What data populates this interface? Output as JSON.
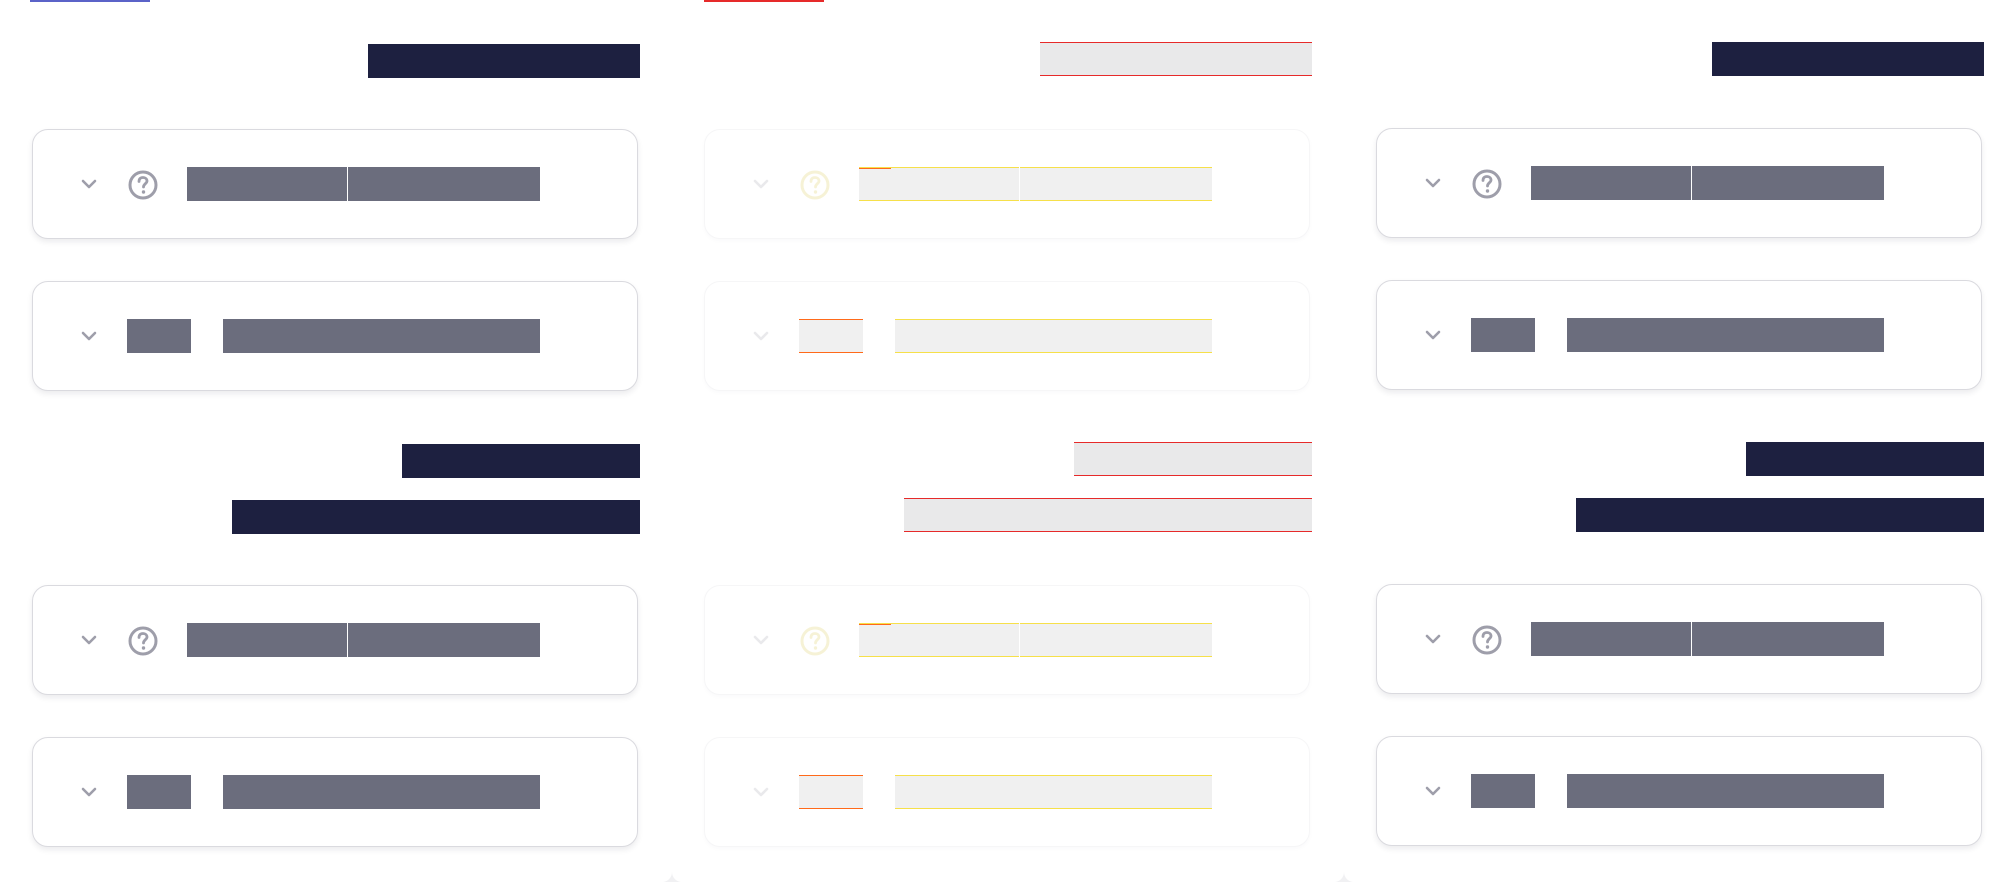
{
  "panels": [
    {
      "headings": [
        "",
        "",
        ""
      ],
      "cards": [
        {
          "icon": "help-circle-icon",
          "value_a": "",
          "value_b": ""
        },
        {
          "code": "",
          "value_a": "",
          "value_b": ""
        },
        {
          "icon": "help-circle-icon",
          "value_a": "",
          "value_b": ""
        },
        {
          "code": "",
          "value_a": "",
          "value_b": ""
        }
      ]
    },
    {
      "headings": [
        "",
        "",
        ""
      ],
      "cards": [
        {
          "icon": "help-circle-icon",
          "value_a": "",
          "value_b": ""
        },
        {
          "code": "",
          "value_a": "",
          "value_b": ""
        },
        {
          "icon": "help-circle-icon",
          "value_a": "",
          "value_b": ""
        },
        {
          "code": "",
          "value_a": "",
          "value_b": ""
        }
      ]
    },
    {
      "headings": [
        "",
        "",
        ""
      ],
      "cards": [
        {
          "icon": "help-circle-icon",
          "value_a": "",
          "value_b": ""
        },
        {
          "code": "",
          "value_a": "",
          "value_b": ""
        },
        {
          "icon": "help-circle-icon",
          "value_a": "",
          "value_b": ""
        },
        {
          "code": "",
          "value_a": "",
          "value_b": ""
        }
      ]
    }
  ],
  "colors": {
    "heading_block": "#1d2040",
    "value_block": "#6b6d7d",
    "card_border": "#dadadf",
    "icon_gray": "#9e9eaa",
    "left_tab_accent": "#5b63c8",
    "middle_tab_accent": "#e62a2a",
    "placeholder_fill": "#e9e9ea"
  },
  "icons": {
    "expand": "chevron-down-icon",
    "help": "help-circle-icon"
  }
}
